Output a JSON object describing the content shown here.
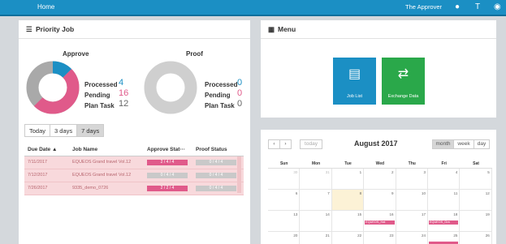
{
  "topbar": {
    "home": "Home",
    "user": "The Approver"
  },
  "priority": {
    "title": "Priority Job",
    "approve": {
      "label": "Approve",
      "processed_label": "Processed",
      "processed": "4",
      "pending_label": "Pending",
      "pending": "16",
      "plan_label": "Plan Task",
      "plan": "12",
      "processed_frac": 0.125,
      "pending_frac": 0.5
    },
    "proof": {
      "label": "Proof",
      "processed_label": "Processed",
      "processed": "0",
      "pending_label": "Pending",
      "pending": "0",
      "plan_label": "Plan Task",
      "plan": "0"
    },
    "tabs": [
      "Today",
      "3 days",
      "7 days"
    ],
    "columns": [
      "Due Date ▲",
      "Job Name",
      "Approve Stat···",
      "Proof Status"
    ],
    "rows": [
      {
        "due": "7/11/2017",
        "name": "EQUEOS Grand travel Vol.12",
        "approve": "2 / 4 / 4",
        "approve_color": "a",
        "proof": "0 / 4 / 4"
      },
      {
        "due": "7/12/2017",
        "name": "EQUEOS Grand travel Vol.12",
        "approve": "0 / 4 / 4",
        "approve_color": "g",
        "proof": "0 / 4 / 4"
      },
      {
        "due": "7/26/2017",
        "name": "9335_demo_0726",
        "approve": "2 / 2 / 4",
        "approve_color": "a",
        "proof": "0 / 4 / 4"
      }
    ]
  },
  "menu": {
    "title": "Menu",
    "items": [
      {
        "label": "Job List",
        "color": "#1b8fc4",
        "icon": "list-icon"
      },
      {
        "label": "Exchange Data",
        "color": "#2aa84a",
        "icon": "exchange-icon"
      }
    ]
  },
  "calendar": {
    "title": "August 2017",
    "today": "today",
    "views": [
      "month",
      "week",
      "day"
    ],
    "weekdays": [
      "Sun",
      "Mon",
      "Tue",
      "Wed",
      "Thu",
      "Fri",
      "Sat"
    ],
    "weeks": [
      [
        {
          "d": "30",
          "o": true
        },
        {
          "d": "31",
          "o": true
        },
        {
          "d": "1"
        },
        {
          "d": "2"
        },
        {
          "d": "3"
        },
        {
          "d": "4"
        },
        {
          "d": "5"
        }
      ],
      [
        {
          "d": "6"
        },
        {
          "d": "7"
        },
        {
          "d": "8",
          "today": true
        },
        {
          "d": "9"
        },
        {
          "d": "10"
        },
        {
          "d": "11"
        },
        {
          "d": "12"
        }
      ],
      [
        {
          "d": "13"
        },
        {
          "d": "14"
        },
        {
          "d": "15"
        },
        {
          "d": "16",
          "event": "EQUEOS_Hat"
        },
        {
          "d": "17"
        },
        {
          "d": "18",
          "event": "EQUEOS_Gra"
        },
        {
          "d": "19"
        }
      ],
      [
        {
          "d": "20"
        },
        {
          "d": "21"
        },
        {
          "d": "22"
        },
        {
          "d": "23"
        },
        {
          "d": "24"
        },
        {
          "d": "25",
          "event": " "
        },
        {
          "d": "26"
        }
      ]
    ]
  },
  "colors": {
    "accent": "#1b8fc4",
    "pending": "#e05a8a",
    "green": "#2aa84a",
    "row_pink": "#f8d9dc"
  }
}
